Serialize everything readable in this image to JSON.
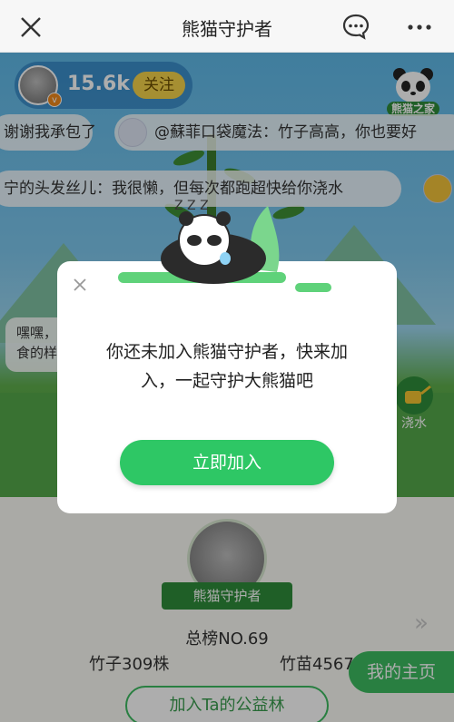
{
  "nav": {
    "title": "熊猫守护者",
    "close_icon": "close-icon",
    "message_icon": "chat-bubble-icon",
    "more_icon": "more-dots-icon"
  },
  "scene": {
    "owner": {
      "count": "15.6k",
      "follow_label": "关注",
      "badge_icon": "vip-badge-icon"
    },
    "home_badge_label": "熊猫之家",
    "danmu": [
      "谢谢我承包了",
      "@蘇菲口袋魔法：竹子高高，你也要好",
      "宁的头发丝儿：我很懒，但每次都跑超快给你浇水"
    ],
    "side_bubble": {
      "line1": "嘿嘿，",
      "line2": "食的样"
    },
    "water_label": "浇水"
  },
  "profile": {
    "ribbon_label": "熊猫守护者",
    "rank": "总榜NO.69",
    "bamboo": "竹子309株",
    "sprout": "竹苗4567",
    "my_home_label": "我的主页",
    "join_forest_label": "加入Ta的公益林",
    "chevron": "»"
  },
  "modal": {
    "message": "你还未加入熊猫守护者，快来加入，一起守护大熊猫吧",
    "join_button": "立即加入",
    "sleep_text": "Z Z Z"
  },
  "colors": {
    "accent_green": "#2ec765",
    "follow_yellow": "#f5d34a",
    "sky_blue": "#5fb9e8"
  }
}
